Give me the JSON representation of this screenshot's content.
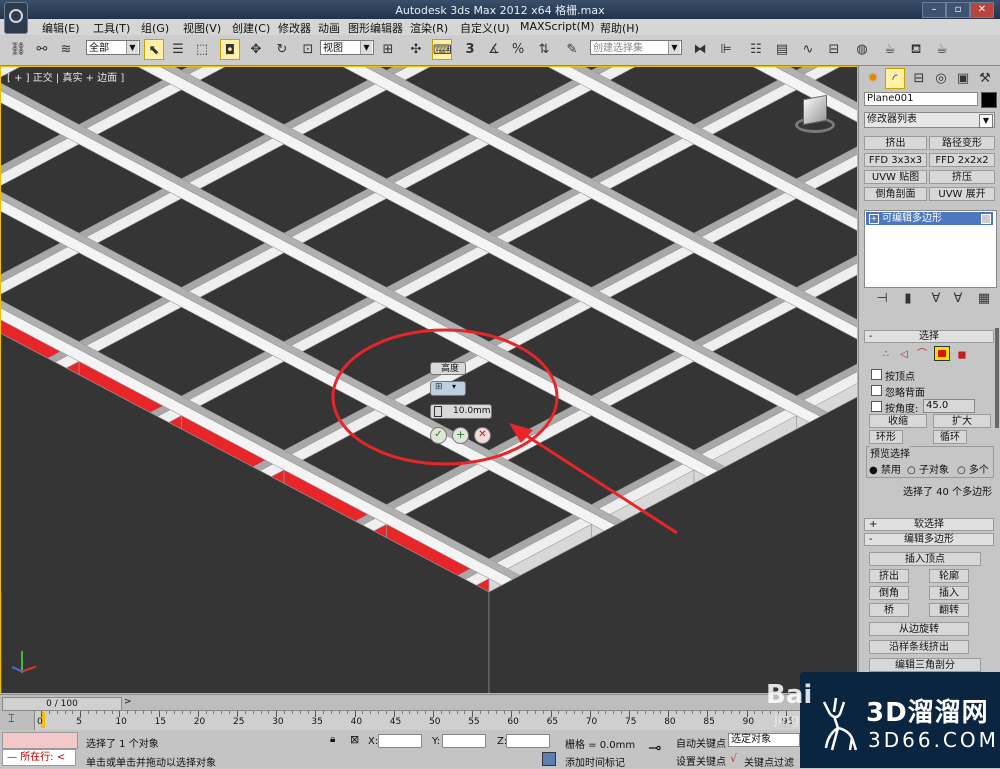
{
  "titlebar": {
    "title": "Autodesk 3ds Max  2012 x64        格栅.max"
  },
  "menu": [
    "编辑(E)",
    "工具(T)",
    "组(G)",
    "视图(V)",
    "创建(C)",
    "修改器",
    "动画",
    "图形编辑器",
    "渲染(R)",
    "自定义(U)",
    "MAXScript(M)",
    "帮助(H)"
  ],
  "toolbar": {
    "filter_value": "全部",
    "refcoord_value": "视图",
    "num3": "3",
    "selection_set_placeholder": "创建选择集"
  },
  "viewport": {
    "label": "[ + ] 正交 | 真实 + 边面 ]",
    "accent_color": "#e8262a",
    "caddy": {
      "height_label": "高度",
      "value": "10.0mm"
    }
  },
  "cmdpanel": {
    "object_name": "Plane001",
    "modifier_list": "修改器列表",
    "mod_buttons": [
      "挤出",
      "路径变形",
      "FFD 3x3x3",
      "FFD 2x2x2",
      "UVW 贴图",
      "挤压",
      "倒角剖面",
      "UVW 展开"
    ],
    "stack_item": "可编辑多边形",
    "select": {
      "title": "选择",
      "by_vertex": "按顶点",
      "ignore_back": "忽略背面",
      "by_angle": "按角度:",
      "angle_value": "45.0",
      "shrink": "收缩",
      "grow": "扩大",
      "ring": "环形",
      "loop": "循环",
      "preview_title": "预览选择",
      "opt_disabled": "禁用",
      "opt_subobj": "子对象",
      "opt_multi": "多个",
      "selected_info": "选择了 40 个多边形"
    },
    "soft_title": "软选择",
    "edit_title": "编辑多边形",
    "edit_buttons": [
      "插入顶点",
      "挤出",
      "轮廓",
      "倒角",
      "插入",
      "桥",
      "翻转",
      "从边旋转",
      "沿样条线挤出",
      "编辑三角剖分"
    ]
  },
  "timeline": {
    "frame": "0 / 100",
    "ticks": [
      "0",
      "5",
      "10",
      "15",
      "20",
      "25",
      "30",
      "35",
      "40",
      "45",
      "50",
      "55",
      "60",
      "65",
      "70",
      "75",
      "80",
      "85",
      "90",
      "95"
    ]
  },
  "status": {
    "mode": "所在行:",
    "selected": "选择了 1 个对象",
    "prompt": "单击或单击并拖动以选择对象",
    "x_label": "X:",
    "y_label": "Y:",
    "z_label": "Z:",
    "grid": "栅格 = 0.0mm",
    "add_time_tag": "添加时间标记",
    "auto_key": "自动关键点",
    "set_key": "设置关键点",
    "key_mode": "选定对象",
    "key_filter": "关键点过滤"
  },
  "watermark": {
    "name": "3D溜溜网",
    "url": "3D66.COM",
    "baidu": "Bai",
    "baidu2": "jing"
  }
}
